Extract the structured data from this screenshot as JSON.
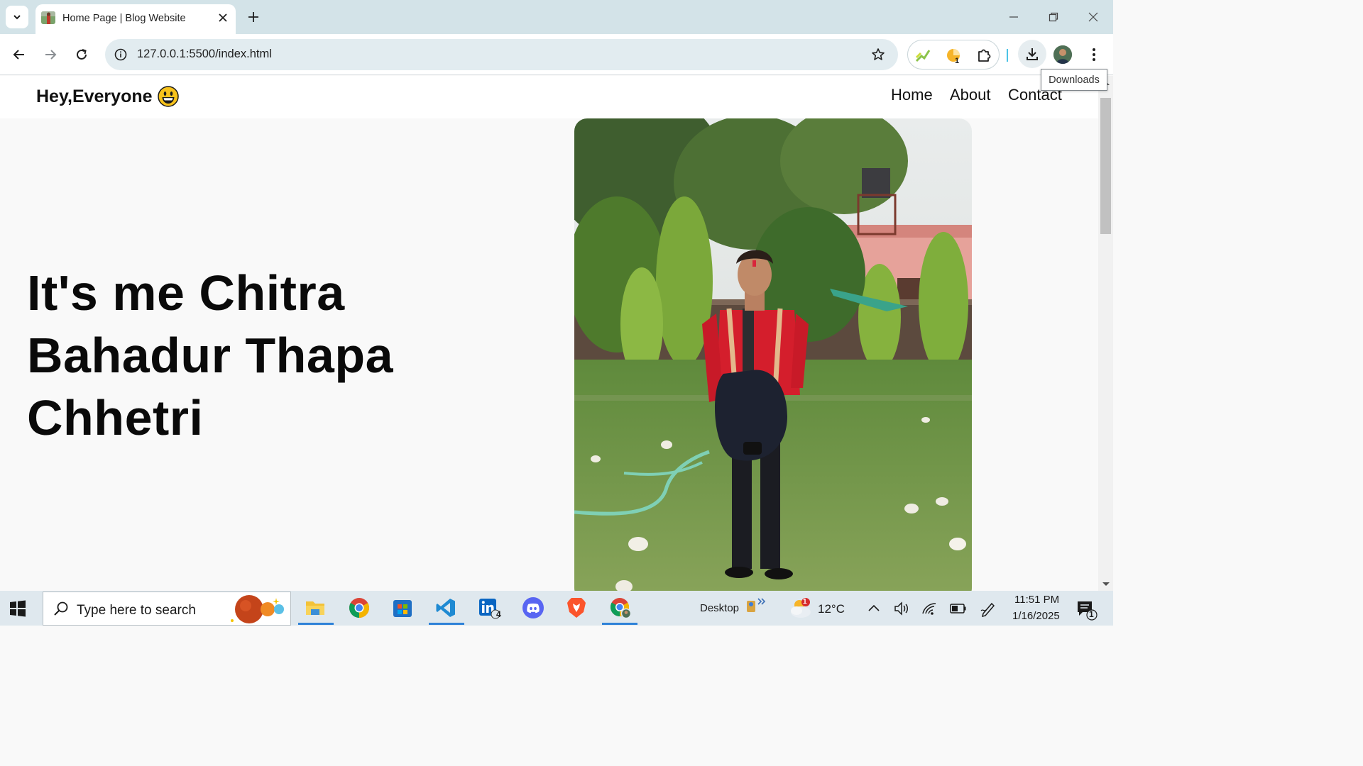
{
  "_layout_note": "The screenshot itself is 1568x882, so the whole page is built at that size.",
  "chrome_tab": {
    "title": "Home Page | Blog Website"
  },
  "address": {
    "url": "127.0.0.1:5500/index.html"
  },
  "ext_badge": "1",
  "tooltip": "Downloads",
  "site": {
    "brand": "Hey,Everyone",
    "brand_emoji": "😃",
    "nav": [
      "Home",
      "About",
      "Contact"
    ],
    "hero_lines": [
      "It's me Chitra",
      "Bahadur Thapa",
      "Chhetri"
    ]
  },
  "taskbar": {
    "search_placeholder": "Type here to search",
    "desktop_label": "Desktop",
    "weather": "12°C",
    "weather_badge": "1",
    "time": "11:51 PM",
    "date": "1/16/2025",
    "notif_count": "1",
    "linkedin_badge": "4"
  },
  "colors": {
    "chrome_top": "#d3e3e8",
    "toolbar": "#ffffff",
    "omnibox": "#e2ecf0",
    "page_bg": "#f9f9f9",
    "taskbar": "#dfe8ee",
    "vscode": "#1f8ad2",
    "discord": "#5865f2",
    "brave": "#fb542b"
  }
}
